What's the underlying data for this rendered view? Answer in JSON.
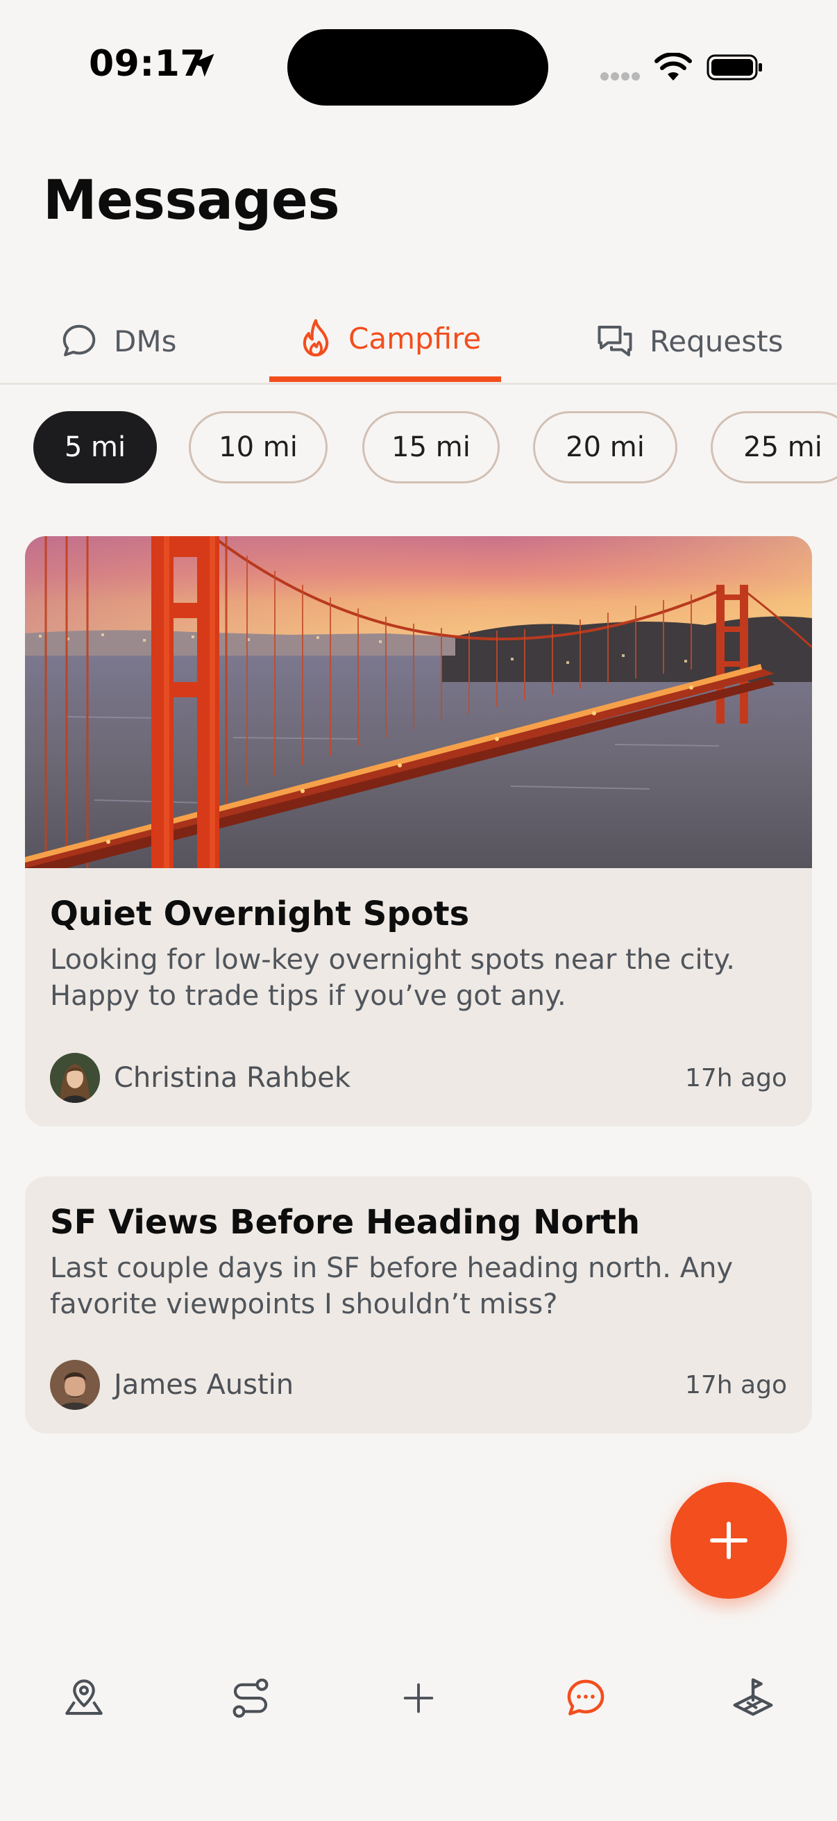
{
  "status_bar": {
    "time": "09:17"
  },
  "header": {
    "title": "Messages"
  },
  "tabs": [
    {
      "label": "DMs",
      "active": false
    },
    {
      "label": "Campfire",
      "active": true
    },
    {
      "label": "Requests",
      "active": false
    }
  ],
  "distance_filters": [
    {
      "label": "5 mi",
      "selected": true
    },
    {
      "label": "10 mi",
      "selected": false
    },
    {
      "label": "15 mi",
      "selected": false
    },
    {
      "label": "20 mi",
      "selected": false
    },
    {
      "label": "25 mi",
      "selected": false
    }
  ],
  "posts": [
    {
      "title": "Quiet Overnight Spots",
      "body": "Looking for low-key overnight spots near the city. Happy to trade tips if you’ve got any.",
      "author": "Christina Rahbek",
      "time_ago": "17h ago",
      "image": "golden-gate-bridge-sunset"
    },
    {
      "title": "SF Views Before Heading North",
      "body": "Last couple days in SF before heading north. Any favorite viewpoints I shouldn’t miss?",
      "author": "James Austin",
      "time_ago": "17h ago"
    }
  ],
  "fab": {
    "icon": "plus-icon"
  },
  "bottom_nav": [
    {
      "icon": "map-pin-icon",
      "active": false
    },
    {
      "icon": "route-icon",
      "active": false
    },
    {
      "icon": "plus-icon",
      "active": false
    },
    {
      "icon": "chat-bubble-icon",
      "active": true
    },
    {
      "icon": "map-flag-icon",
      "active": false
    }
  ],
  "colors": {
    "accent": "#F24E1E",
    "background": "#F7F5F3",
    "card": "#EEE9E4",
    "chip_active": "#1C1C1E",
    "chip_border": "#D2C0B4",
    "muted_text": "#50555C"
  }
}
